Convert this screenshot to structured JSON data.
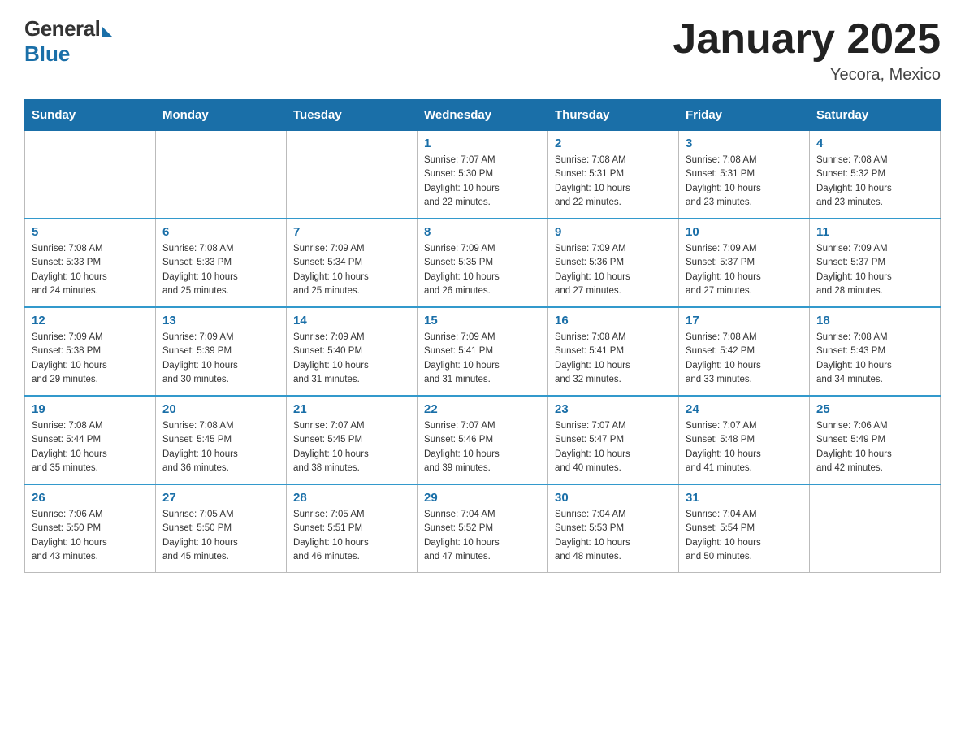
{
  "header": {
    "logo_general": "General",
    "logo_blue": "Blue",
    "title": "January 2025",
    "location": "Yecora, Mexico"
  },
  "days_of_week": [
    "Sunday",
    "Monday",
    "Tuesday",
    "Wednesday",
    "Thursday",
    "Friday",
    "Saturday"
  ],
  "weeks": [
    [
      {
        "num": "",
        "info": ""
      },
      {
        "num": "",
        "info": ""
      },
      {
        "num": "",
        "info": ""
      },
      {
        "num": "1",
        "info": "Sunrise: 7:07 AM\nSunset: 5:30 PM\nDaylight: 10 hours\nand 22 minutes."
      },
      {
        "num": "2",
        "info": "Sunrise: 7:08 AM\nSunset: 5:31 PM\nDaylight: 10 hours\nand 22 minutes."
      },
      {
        "num": "3",
        "info": "Sunrise: 7:08 AM\nSunset: 5:31 PM\nDaylight: 10 hours\nand 23 minutes."
      },
      {
        "num": "4",
        "info": "Sunrise: 7:08 AM\nSunset: 5:32 PM\nDaylight: 10 hours\nand 23 minutes."
      }
    ],
    [
      {
        "num": "5",
        "info": "Sunrise: 7:08 AM\nSunset: 5:33 PM\nDaylight: 10 hours\nand 24 minutes."
      },
      {
        "num": "6",
        "info": "Sunrise: 7:08 AM\nSunset: 5:33 PM\nDaylight: 10 hours\nand 25 minutes."
      },
      {
        "num": "7",
        "info": "Sunrise: 7:09 AM\nSunset: 5:34 PM\nDaylight: 10 hours\nand 25 minutes."
      },
      {
        "num": "8",
        "info": "Sunrise: 7:09 AM\nSunset: 5:35 PM\nDaylight: 10 hours\nand 26 minutes."
      },
      {
        "num": "9",
        "info": "Sunrise: 7:09 AM\nSunset: 5:36 PM\nDaylight: 10 hours\nand 27 minutes."
      },
      {
        "num": "10",
        "info": "Sunrise: 7:09 AM\nSunset: 5:37 PM\nDaylight: 10 hours\nand 27 minutes."
      },
      {
        "num": "11",
        "info": "Sunrise: 7:09 AM\nSunset: 5:37 PM\nDaylight: 10 hours\nand 28 minutes."
      }
    ],
    [
      {
        "num": "12",
        "info": "Sunrise: 7:09 AM\nSunset: 5:38 PM\nDaylight: 10 hours\nand 29 minutes."
      },
      {
        "num": "13",
        "info": "Sunrise: 7:09 AM\nSunset: 5:39 PM\nDaylight: 10 hours\nand 30 minutes."
      },
      {
        "num": "14",
        "info": "Sunrise: 7:09 AM\nSunset: 5:40 PM\nDaylight: 10 hours\nand 31 minutes."
      },
      {
        "num": "15",
        "info": "Sunrise: 7:09 AM\nSunset: 5:41 PM\nDaylight: 10 hours\nand 31 minutes."
      },
      {
        "num": "16",
        "info": "Sunrise: 7:08 AM\nSunset: 5:41 PM\nDaylight: 10 hours\nand 32 minutes."
      },
      {
        "num": "17",
        "info": "Sunrise: 7:08 AM\nSunset: 5:42 PM\nDaylight: 10 hours\nand 33 minutes."
      },
      {
        "num": "18",
        "info": "Sunrise: 7:08 AM\nSunset: 5:43 PM\nDaylight: 10 hours\nand 34 minutes."
      }
    ],
    [
      {
        "num": "19",
        "info": "Sunrise: 7:08 AM\nSunset: 5:44 PM\nDaylight: 10 hours\nand 35 minutes."
      },
      {
        "num": "20",
        "info": "Sunrise: 7:08 AM\nSunset: 5:45 PM\nDaylight: 10 hours\nand 36 minutes."
      },
      {
        "num": "21",
        "info": "Sunrise: 7:07 AM\nSunset: 5:45 PM\nDaylight: 10 hours\nand 38 minutes."
      },
      {
        "num": "22",
        "info": "Sunrise: 7:07 AM\nSunset: 5:46 PM\nDaylight: 10 hours\nand 39 minutes."
      },
      {
        "num": "23",
        "info": "Sunrise: 7:07 AM\nSunset: 5:47 PM\nDaylight: 10 hours\nand 40 minutes."
      },
      {
        "num": "24",
        "info": "Sunrise: 7:07 AM\nSunset: 5:48 PM\nDaylight: 10 hours\nand 41 minutes."
      },
      {
        "num": "25",
        "info": "Sunrise: 7:06 AM\nSunset: 5:49 PM\nDaylight: 10 hours\nand 42 minutes."
      }
    ],
    [
      {
        "num": "26",
        "info": "Sunrise: 7:06 AM\nSunset: 5:50 PM\nDaylight: 10 hours\nand 43 minutes."
      },
      {
        "num": "27",
        "info": "Sunrise: 7:05 AM\nSunset: 5:50 PM\nDaylight: 10 hours\nand 45 minutes."
      },
      {
        "num": "28",
        "info": "Sunrise: 7:05 AM\nSunset: 5:51 PM\nDaylight: 10 hours\nand 46 minutes."
      },
      {
        "num": "29",
        "info": "Sunrise: 7:04 AM\nSunset: 5:52 PM\nDaylight: 10 hours\nand 47 minutes."
      },
      {
        "num": "30",
        "info": "Sunrise: 7:04 AM\nSunset: 5:53 PM\nDaylight: 10 hours\nand 48 minutes."
      },
      {
        "num": "31",
        "info": "Sunrise: 7:04 AM\nSunset: 5:54 PM\nDaylight: 10 hours\nand 50 minutes."
      },
      {
        "num": "",
        "info": ""
      }
    ]
  ]
}
